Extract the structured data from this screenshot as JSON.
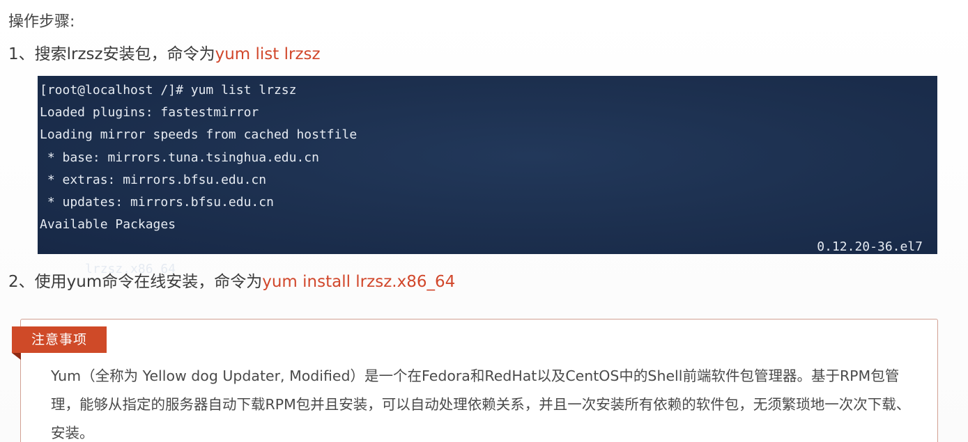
{
  "heading": "操作步骤:",
  "step1": {
    "prefix": "1、搜索lrzsz安装包，命令为",
    "command": "yum list lrzsz"
  },
  "terminal": {
    "lines": [
      "[root@localhost /]# yum list lrzsz",
      "Loaded plugins: fastestmirror",
      "Loading mirror speeds from cached hostfile",
      " * base: mirrors.tuna.tsinghua.edu.cn",
      " * extras: mirrors.bfsu.edu.cn",
      " * updates: mirrors.bfsu.edu.cn",
      "Available Packages",
      "lrzsz.x86_64"
    ],
    "package_version": "0.12.20-36.el7"
  },
  "step2": {
    "prefix": "2、使用yum命令在线安装，命令为",
    "command": "yum install lrzsz.x86_64"
  },
  "notice": {
    "tag": "注意事项",
    "body": "Yum（全称为 Yellow dog Updater, Modified）是一个在Fedora和RedHat以及CentOS中的Shell前端软件包管理器。基于RPM包管理，能够从指定的服务器自动下载RPM包并且安装，可以自动处理依赖关系，并且一次安装所有依赖的软件包，无须繁琐地一次次下载、安装。"
  },
  "colors": {
    "command_text": "#d1472b",
    "terminal_bg": "#1c2f4e",
    "notice_tag_bg": "#cf4a28",
    "notice_border": "#d2a093"
  }
}
